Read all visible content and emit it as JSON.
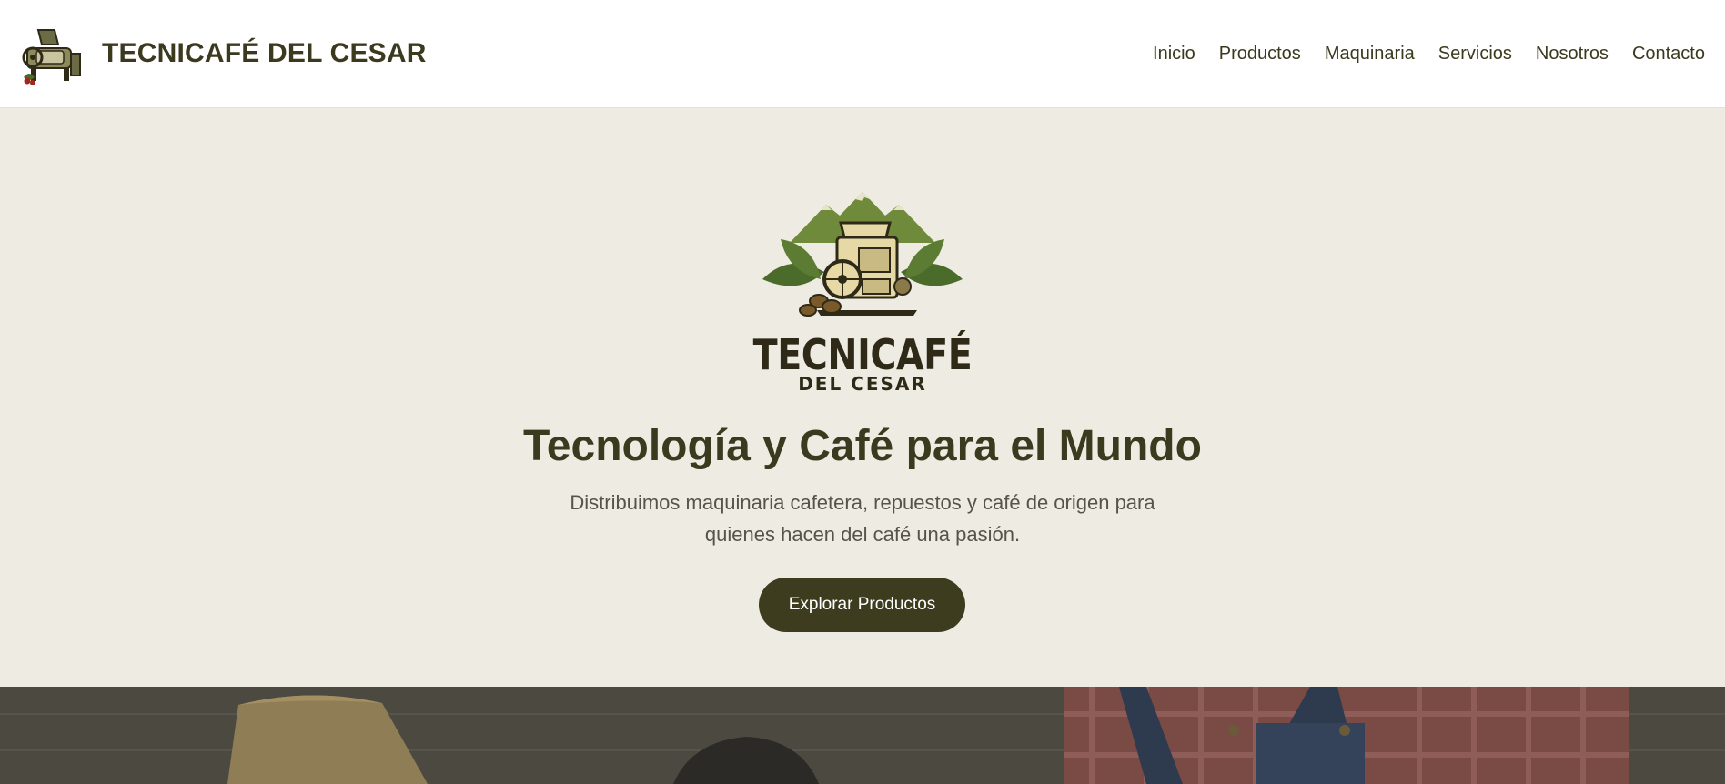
{
  "header": {
    "brand_name": "TECNICAFÉ DEL CESAR",
    "logo_icon": "coffee-machine-icon",
    "nav": [
      {
        "label": "Inicio"
      },
      {
        "label": "Productos"
      },
      {
        "label": "Maquinaria"
      },
      {
        "label": "Servicios"
      },
      {
        "label": "Nosotros"
      },
      {
        "label": "Contacto"
      }
    ]
  },
  "hero": {
    "emblem": {
      "icon": "coffee-machine-emblem-icon",
      "title": "TECNICAFÉ",
      "subtitle": "DEL CESAR"
    },
    "title": "Tecnología y Café para el Mundo",
    "description": "Distribuimos maquinaria cafetera, repuestos y café de origen para quienes hacen del café una pasión.",
    "cta_label": "Explorar Productos"
  },
  "colors": {
    "primary": "#3d3c1f",
    "background": "#eeebe3",
    "header_bg": "#ffffff",
    "accent_green": "#6e8a3a"
  }
}
